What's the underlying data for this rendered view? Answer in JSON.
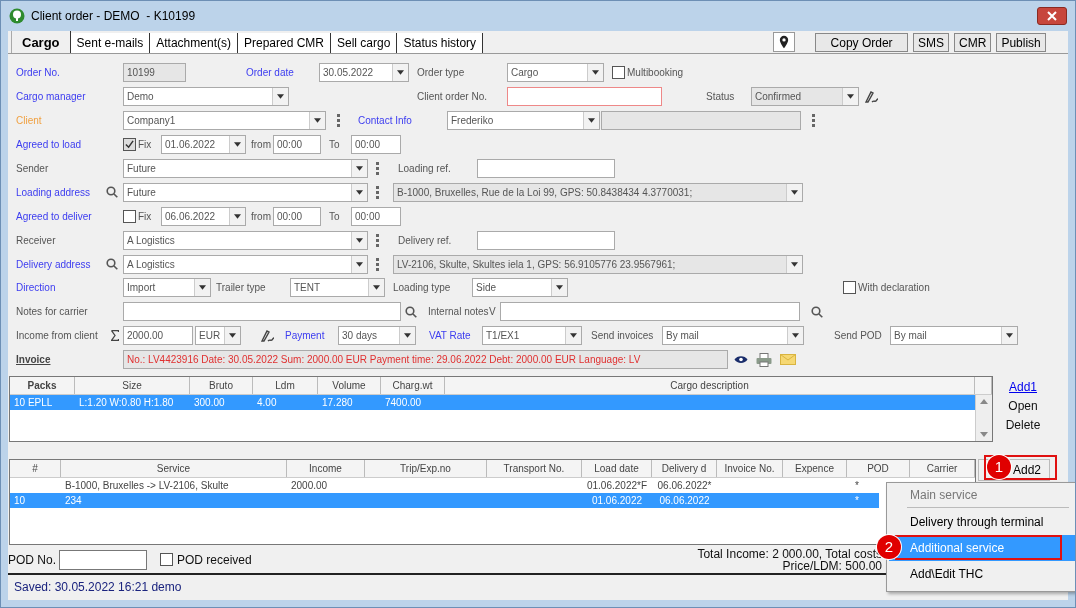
{
  "window": {
    "title": "Client order - DEMO  - K10199"
  },
  "tabs": [
    {
      "label": "Cargo",
      "selected": true
    },
    {
      "label": "Sent e-mails",
      "selected": false
    },
    {
      "label": "Attachment(s)",
      "selected": false
    },
    {
      "label": "Prepared CMR",
      "selected": false
    },
    {
      "label": "Sell cargo",
      "selected": false
    },
    {
      "label": "Status history",
      "selected": false
    }
  ],
  "toolbar": [
    "Copy Order",
    "SMS",
    "CMR",
    "Publish"
  ],
  "form": {
    "lines": [
      {
        "items": [
          {
            "kind": "link",
            "text": "Order No."
          },
          {
            "kind": "field",
            "value": "10199",
            "disabled": true
          },
          {
            "kind": "link",
            "text": "Order date"
          },
          {
            "kind": "combo",
            "value": "30.05.2022",
            "disabled": false
          },
          {
            "kind": "label",
            "text": "Order type"
          },
          {
            "kind": "combo",
            "value": "Cargo",
            "disabled": false
          },
          {
            "kind": "check",
            "text": "Multibooking",
            "checked": false
          }
        ]
      },
      {
        "items": [
          {
            "kind": "link",
            "text": "Cargo manager"
          },
          {
            "kind": "combo",
            "value": "Demo",
            "disabled": false
          },
          {
            "kind": "label",
            "text": "Client order No."
          },
          {
            "kind": "field",
            "disabled": false,
            "invalid": true
          },
          {
            "kind": "label",
            "text": "Status"
          },
          {
            "kind": "combo",
            "value": "Confirmed",
            "disabled": true
          },
          {
            "kind": "sign"
          }
        ]
      },
      {
        "items": [
          {
            "kind": "accent",
            "text": "Client"
          },
          {
            "kind": "combo",
            "value": "Company1",
            "disabled": false
          },
          {
            "kind": "more"
          },
          {
            "kind": "link",
            "text": "Contact Info"
          },
          {
            "kind": "combo",
            "value": "Frederiko",
            "disabled": false
          },
          {
            "kind": "field",
            "disabled": true
          },
          {
            "kind": "more"
          }
        ]
      },
      {
        "items": [
          {
            "kind": "link",
            "text": "Agreed to load"
          },
          {
            "kind": "check",
            "text": "Fix",
            "checked": true
          },
          {
            "kind": "combo",
            "value": "01.06.2022",
            "disabled": false
          },
          {
            "kind": "label",
            "text": "from"
          },
          {
            "kind": "field",
            "value": "00:00",
            "disabled": false
          },
          {
            "kind": "label",
            "text": "To"
          },
          {
            "kind": "field",
            "value": "00:00",
            "disabled": false
          }
        ]
      },
      {
        "items": [
          {
            "kind": "label",
            "text": "Sender"
          },
          {
            "kind": "combo",
            "value": "Future",
            "disabled": false
          },
          {
            "kind": "more"
          },
          {
            "kind": "label",
            "text": "Loading ref."
          },
          {
            "kind": "field",
            "disabled": false
          }
        ]
      },
      {
        "items": [
          {
            "kind": "link",
            "text": "Loading address"
          },
          {
            "kind": "search"
          },
          {
            "kind": "combo",
            "value": "Future",
            "disabled": false
          },
          {
            "kind": "more"
          },
          {
            "kind": "combo",
            "value": "B-1000, Bruxelles, Rue de la Loi 99, GPS: 50.8438434 4.3770031;",
            "disabled": true
          }
        ]
      },
      {
        "items": [
          {
            "kind": "link",
            "text": "Agreed to deliver"
          },
          {
            "kind": "check",
            "text": "Fix",
            "checked": false
          },
          {
            "kind": "combo",
            "value": "06.06.2022",
            "disabled": false
          },
          {
            "kind": "label",
            "text": "from"
          },
          {
            "kind": "field",
            "value": "00:00",
            "disabled": false
          },
          {
            "kind": "label",
            "text": "To"
          },
          {
            "kind": "field",
            "value": "00:00",
            "disabled": false
          }
        ]
      },
      {
        "items": [
          {
            "kind": "label",
            "text": "Receiver"
          },
          {
            "kind": "combo",
            "value": "A Logistics",
            "disabled": false
          },
          {
            "kind": "more"
          },
          {
            "kind": "label",
            "text": "Delivery ref."
          },
          {
            "kind": "field",
            "disabled": false
          }
        ]
      },
      {
        "items": [
          {
            "kind": "link",
            "text": "Delivery address"
          },
          {
            "kind": "search"
          },
          {
            "kind": "combo",
            "value": "A Logistics",
            "disabled": false
          },
          {
            "kind": "more"
          },
          {
            "kind": "combo",
            "value": "LV-2106, Skulte, Skultes iela 1, GPS: 56.9105776 23.9567961;",
            "disabled": true
          }
        ]
      },
      {
        "items": [
          {
            "kind": "link",
            "text": "Direction"
          },
          {
            "kind": "combo",
            "value": "Import",
            "disabled": false
          },
          {
            "kind": "label",
            "text": "Trailer type"
          },
          {
            "kind": "combo",
            "value": "TENT",
            "disabled": false
          },
          {
            "kind": "label",
            "text": "Loading type"
          },
          {
            "kind": "combo",
            "value": "Side",
            "disabled": false
          },
          {
            "kind": "check",
            "text": "With declaration",
            "checked": false
          }
        ]
      },
      {
        "items": [
          {
            "kind": "label",
            "text": "Notes for carrier"
          },
          {
            "kind": "field",
            "disabled": false
          },
          {
            "kind": "search"
          },
          {
            "kind": "label",
            "text": "Internal notes"
          },
          {
            "kind": "label",
            "text": "V"
          },
          {
            "kind": "field",
            "disabled": false
          },
          {
            "kind": "search"
          }
        ]
      },
      {
        "items": [
          {
            "kind": "label",
            "text": "Income from client"
          },
          {
            "kind": "sum"
          },
          {
            "kind": "field",
            "value": "2000.00",
            "disabled": false
          },
          {
            "kind": "combo",
            "value": "EUR",
            "disabled": false
          },
          {
            "kind": "sign"
          },
          {
            "kind": "link",
            "text": "Payment"
          },
          {
            "kind": "combo",
            "value": "30 days",
            "disabled": false
          },
          {
            "kind": "link",
            "text": "VAT Rate"
          },
          {
            "kind": "combo",
            "value": "T1/EX1",
            "disabled": false
          },
          {
            "kind": "label",
            "text": "Send invoices"
          },
          {
            "kind": "combo",
            "value": "By mail",
            "disabled": false
          },
          {
            "kind": "label",
            "text": "Send POD"
          },
          {
            "kind": "combo",
            "value": "By mail",
            "disabled": false
          }
        ]
      },
      {
        "items": [
          {
            "kind": "heading",
            "text": "Invoice"
          },
          {
            "kind": "field",
            "value": "No.: LV4423916 Date: 30.05.2022 Sum: 2000.00 EUR Payment time: 29.06.2022 Debt: 2000.00 EUR Language: LV",
            "disabled": true,
            "warning": true
          },
          {
            "kind": "eye"
          },
          {
            "kind": "print"
          },
          {
            "kind": "mail"
          }
        ]
      }
    ]
  },
  "cargo_table": {
    "columns": [
      "Packs",
      "Size",
      "Bruto",
      "Ldm",
      "Volume",
      "Charg.wt",
      "Cargo description"
    ],
    "rows": [
      {
        "cells": [
          "10 EPLL",
          "L:1.20 W:0.80 H:1.80",
          "300.00",
          "4.00",
          "17.280",
          "7400.00",
          null
        ],
        "selected": true
      }
    ],
    "actions": [
      {
        "label": "Add1",
        "kind": "link"
      },
      {
        "label": "Open",
        "kind": "plain"
      },
      {
        "label": "Delete",
        "kind": "plain"
      }
    ]
  },
  "service_table": {
    "columns": [
      "#",
      "Service",
      "Income",
      "Trip/Exp.no",
      "Transport No.",
      "Load date",
      "Delivery d",
      "Invoice No.",
      "Expence",
      "POD",
      "Carrier"
    ],
    "rows": [
      {
        "cells": [
          null,
          "B-1000, Bruxelles -> LV-2106, Skulte",
          "2000.00",
          null,
          null,
          "01.06.2022*F",
          "06.06.2022*",
          null,
          null,
          "*",
          null
        ],
        "selected": false
      },
      {
        "cells": [
          "10",
          "234",
          null,
          null,
          null,
          "01.06.2022",
          "06.06.2022",
          null,
          null,
          "*",
          null
        ],
        "selected": true
      }
    ],
    "add_button": "Add2"
  },
  "pod": {
    "label": "POD No.",
    "received_label": "POD received",
    "received": false
  },
  "totals": [
    "Total Income: 2 000.00, Total costs",
    "Price/LDM: 500.00"
  ],
  "status_bar": "Saved: 30.05.2022 16:21 demo",
  "menu": {
    "items": [
      {
        "label": "Main service",
        "disabled": true,
        "selected": false
      },
      {
        "label": "Delivery through terminal",
        "disabled": false,
        "selected": false
      },
      {
        "label": "Additional service",
        "disabled": false,
        "selected": true
      },
      {
        "label": "Add\\Edit THC",
        "disabled": false,
        "selected": false
      }
    ]
  },
  "callouts": [
    "1",
    "2"
  ]
}
